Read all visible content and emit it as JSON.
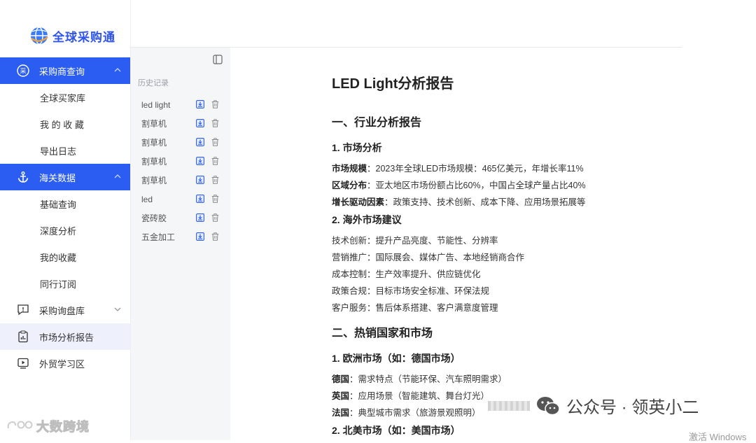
{
  "brand": {
    "name": "全球采购通",
    "bottom_logo": "大数跨境"
  },
  "colors": {
    "accent": "#2b5df2",
    "selected_bg": "#eef1fb",
    "panel_bg": "#f5f6f8"
  },
  "sidebar": {
    "items": [
      {
        "type": "parent",
        "label": "采购商查询",
        "icon": "buyer-search-icon",
        "active": true,
        "caret": "up"
      },
      {
        "type": "child",
        "label": "全球买家库"
      },
      {
        "type": "child",
        "label": "我 的 收 藏"
      },
      {
        "type": "child",
        "label": "导出日志"
      },
      {
        "type": "parent",
        "label": "海关数据",
        "icon": "anchor-icon",
        "active": true,
        "caret": "up"
      },
      {
        "type": "child",
        "label": "基础查询"
      },
      {
        "type": "child",
        "label": "深度分析"
      },
      {
        "type": "child",
        "label": "我的收藏"
      },
      {
        "type": "child",
        "label": "同行订阅"
      },
      {
        "type": "parent",
        "label": "采购询盘库",
        "icon": "inquiry-icon",
        "active": false,
        "caret": "down"
      },
      {
        "type": "parent",
        "label": "市场分析报告",
        "icon": "report-icon",
        "active": false,
        "selected": true
      },
      {
        "type": "parent",
        "label": "外贸学习区",
        "icon": "learning-icon",
        "active": false
      }
    ]
  },
  "history": {
    "title": "历史记录",
    "items": [
      "led light",
      "割草机",
      "割草机",
      "割草机",
      "割草机",
      "led",
      "瓷砖胶",
      "五金加工"
    ]
  },
  "report": {
    "title": "LED Light分析报告",
    "section1": "一、行业分析报告",
    "s1_sub1": "1. 市场分析",
    "market_size": {
      "key": "市场规模",
      "value": "：2023年全球LED市场规模：465亿美元，年增长率11%"
    },
    "region": {
      "key": "区域分布",
      "value": "：亚太地区市场份额占比60%，中国占全球产量占比40%"
    },
    "drivers": {
      "key": "增长驱动因素",
      "value": "：政策支持、技术创新、成本下降、应用场景拓展等"
    },
    "s1_sub2": "2. 海外市场建议",
    "advice": [
      "技术创新：提升产品亮度、节能性、分辨率",
      "营销推广：国际展会、媒体广告、本地经销商合作",
      "成本控制：生产效率提升、供应链优化",
      "政策合规：目标市场安全标准、环保法规",
      "客户服务：售后体系搭建、客户满意度管理"
    ],
    "section2": "二、热销国家和市场",
    "s2_sub1": "1. 欧洲市场（如：德国市场）",
    "germany": {
      "key": "德国",
      "value": "：需求特点（节能环保、汽车照明需求）"
    },
    "uk": {
      "key": "英国",
      "value": "：应用场景（智能建筑、舞台灯光）"
    },
    "france": {
      "key": "法国",
      "value": "：典型城市需求（旅游景观照明）"
    },
    "s2_sub2": "2. 北美市场（如：美国市场）"
  },
  "watermark": {
    "text": "公众号 · 领英小二",
    "activate": "激活 Windows"
  }
}
